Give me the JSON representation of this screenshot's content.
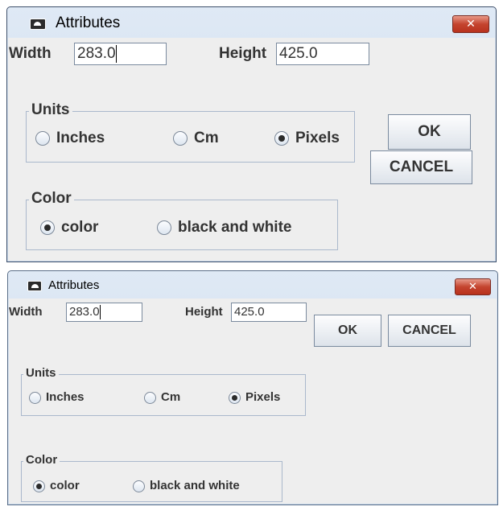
{
  "dialogs": [
    {
      "title": "Attributes",
      "close_glyph": "✕",
      "width_label": "Width",
      "width_value": "283.0",
      "height_label": "Height",
      "height_value": "425.0",
      "units": {
        "title": "Units",
        "options": [
          "Inches",
          "Cm",
          "Pixels"
        ],
        "selected": "Pixels"
      },
      "color": {
        "title": "Color",
        "options": [
          "color",
          "black and white"
        ],
        "selected": "color"
      },
      "ok_label": "OK",
      "cancel_label": "CANCEL"
    },
    {
      "title": "Attributes",
      "close_glyph": "✕",
      "width_label": "Width",
      "width_value": "283.0",
      "height_label": "Height",
      "height_value": "425.0",
      "units": {
        "title": "Units",
        "options": [
          "Inches",
          "Cm",
          "Pixels"
        ],
        "selected": "Pixels"
      },
      "color": {
        "title": "Color",
        "options": [
          "color",
          "black and white"
        ],
        "selected": "color"
      },
      "ok_label": "OK",
      "cancel_label": "CANCEL"
    }
  ],
  "colors": {
    "window_frame": "#c9d9ec",
    "content_background": "#eeeeee",
    "close_button": "#c4442f",
    "group_border": "#aab8cc"
  },
  "icons": {
    "app": "java-coffee-icon",
    "close": "close-icon",
    "radio_on": "radio-selected-icon",
    "radio_off": "radio-unselected-icon"
  }
}
